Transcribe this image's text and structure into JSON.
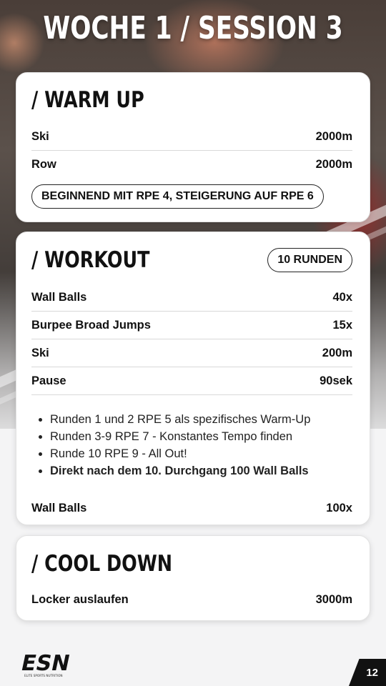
{
  "title": "WOCHE 1 / SESSION 3",
  "warmup": {
    "title": "/ WARM UP",
    "rows": [
      {
        "label": "Ski",
        "value": "2000m"
      },
      {
        "label": "Row",
        "value": "2000m"
      }
    ],
    "note": "BEGINNEND MIT RPE 4, STEIGERUNG AUF RPE 6"
  },
  "workout": {
    "title": "/ WORKOUT",
    "badge": "10 RUNDEN",
    "rows": [
      {
        "label": "Wall Balls",
        "value": "40x"
      },
      {
        "label": "Burpee Broad Jumps",
        "value": "15x"
      },
      {
        "label": "Ski",
        "value": "200m"
      },
      {
        "label": "Pause",
        "value": "90sek"
      }
    ],
    "bullets": [
      "Runden 1 und 2 RPE 5 als spezifisches Warm-Up",
      "Runden 3-9 RPE 7 - Konstantes Tempo finden",
      "Runde 10 RPE 9 - All Out!",
      "Direkt nach dem 10. Durchgang  100 Wall Balls"
    ],
    "final_row": {
      "label": "Wall Balls",
      "value": "100x"
    }
  },
  "cooldown": {
    "title": "/ COOL DOWN",
    "rows": [
      {
        "label": "Locker auslaufen",
        "value": "3000m"
      }
    ]
  },
  "footer": {
    "logo_text": "ESN",
    "logo_tagline": "ELITE SPORTS NUTRITION",
    "page_number": "12"
  }
}
